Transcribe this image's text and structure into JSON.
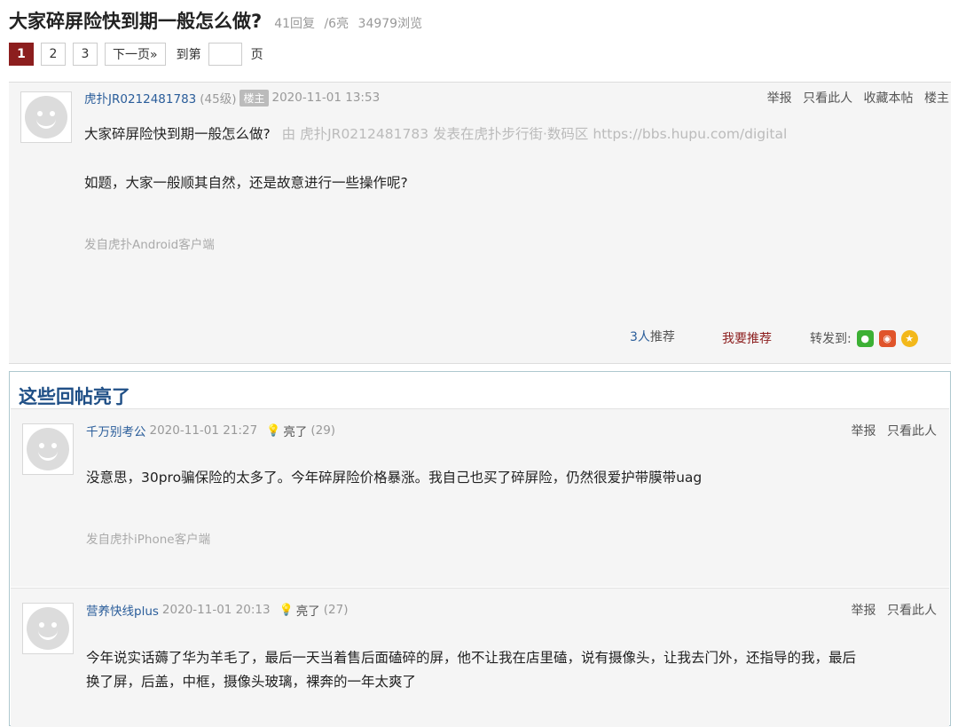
{
  "thread": {
    "title": "大家碎屏险快到期一般怎么做?",
    "replies": "41回复",
    "lights": "/6亮",
    "views": "34979浏览"
  },
  "pagination": {
    "pages": [
      "1",
      "2",
      "3"
    ],
    "active_page": "1",
    "next_label": "下一页»",
    "goto_label": "到第",
    "page_suffix": "页",
    "jump_value": ""
  },
  "main_post": {
    "username": "虎扑JR0212481783",
    "level": "(45级)",
    "role_badge": "楼主",
    "time": "2020-11-01 13:53",
    "actions": [
      "举报",
      "只看此人",
      "收藏本帖",
      "楼主"
    ],
    "title_line": "大家碎屏险快到期一般怎么做?",
    "from_line": "由 虎扑JR0212481783 发表在虎扑步行街·数码区 https://bbs.hupu.com/digital",
    "body": "如题，大家一般顺其自然，还是故意进行一些操作呢?",
    "source": "发自虎扑Android客户端",
    "recommend_count": "3人",
    "recommend_label": "推荐",
    "want_recommend": "我要推荐",
    "share_label": "转发到:",
    "share_icons": [
      "wechat-icon",
      "weibo-icon",
      "qzone-icon"
    ]
  },
  "highlights": {
    "title": "这些回帖亮了",
    "replies": [
      {
        "username": "千万别考公",
        "time": "2020-11-01 21:27",
        "lit_label": "亮了",
        "lit_count": "(29)",
        "actions": [
          "举报",
          "只看此人"
        ],
        "body": "没意思，30pro骗保险的太多了。今年碎屏险价格暴涨。我自己也买了碎屏险，仍然很爱护带膜带uag",
        "source": "发自虎扑iPhone客户端"
      },
      {
        "username": "营养快线plus",
        "time": "2020-11-01 20:13",
        "lit_label": "亮了",
        "lit_count": "(27)",
        "actions": [
          "举报",
          "只看此人"
        ],
        "body_line1": "今年说实话薅了华为羊毛了，最后一天当着售后面磕碎的屏，他不让我在店里磕，说有摄像头，让我去门外，还指导的我，最后",
        "body_line2": "换了屏，后盖，中框，摄像头玻璃，裸奔的一年太爽了"
      }
    ]
  },
  "colors": {
    "accent_red": "#8c1e1e",
    "link_blue": "#2a5d9a",
    "heading_blue": "#1f4f86"
  }
}
